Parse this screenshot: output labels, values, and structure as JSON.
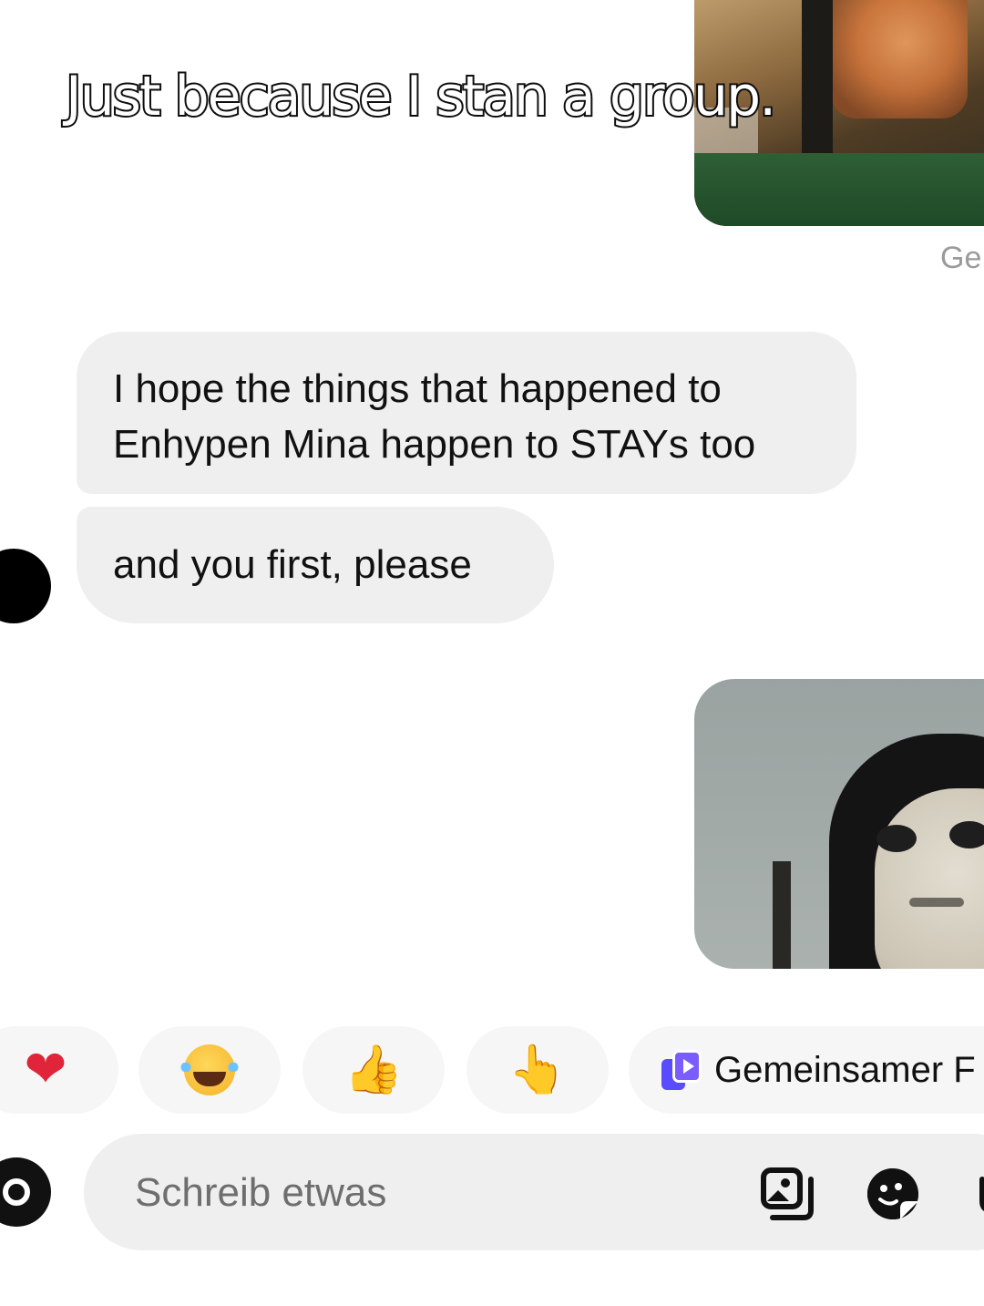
{
  "overlay": {
    "caption": "Just because I stan a group."
  },
  "thread": {
    "status_partial": "Ge",
    "messages": [
      {
        "text": "I hope the things that happened to Enhypen Mina happen to STAYs too"
      },
      {
        "text": "and you first, please"
      }
    ]
  },
  "quick_reactions": {
    "items": [
      {
        "icon": "heart-icon",
        "glyph": "❤"
      },
      {
        "icon": "laughing-face-icon",
        "glyph": "😂"
      },
      {
        "icon": "thumbs-up-icon",
        "glyph": "👍"
      },
      {
        "icon": "pointing-hand-icon",
        "glyph": "👆"
      }
    ],
    "shared_label": "Gemeinsamer F"
  },
  "composer": {
    "placeholder": "Schreib etwas",
    "value": ""
  },
  "colors": {
    "bubble_received": "#efefef",
    "heart": "#e0243a",
    "shared_icon": "#7a5cff"
  }
}
